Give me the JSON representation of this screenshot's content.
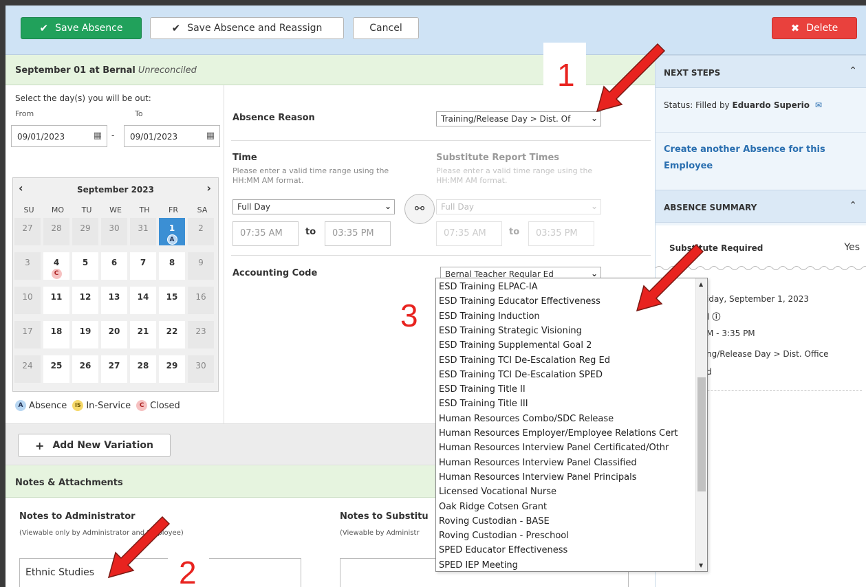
{
  "toolbar": {
    "save_absence": "Save Absence",
    "save_reassign": "Save Absence and Reassign",
    "cancel": "Cancel",
    "delete": "Delete"
  },
  "absence": {
    "title": "September 01 at Bernal",
    "status": "Unreconciled",
    "select_days": "Select the day(s) you will be out:",
    "from_label": "From",
    "to_label": "To",
    "from_date": "09/01/2023",
    "to_date": "09/01/2023",
    "dash": "-"
  },
  "calendar": {
    "title": "September 2023",
    "days_of_week": [
      "SU",
      "MO",
      "TU",
      "WE",
      "TH",
      "FR",
      "SA"
    ],
    "weeks": [
      [
        "27",
        "28",
        "29",
        "30",
        "31",
        "1",
        "2"
      ],
      [
        "3",
        "4",
        "5",
        "6",
        "7",
        "8",
        "9"
      ],
      [
        "10",
        "11",
        "12",
        "13",
        "14",
        "15",
        "16"
      ],
      [
        "17",
        "18",
        "19",
        "20",
        "21",
        "22",
        "23"
      ],
      [
        "24",
        "25",
        "26",
        "27",
        "28",
        "29",
        "30"
      ]
    ],
    "selected_badge": "A",
    "closed_badge": "C"
  },
  "legend": {
    "absence_badge": "A",
    "absence": "Absence",
    "inservice_badge": "IS",
    "inservice": "In-Service",
    "closed_badge": "C",
    "closed": "Closed"
  },
  "form": {
    "absence_reason_label": "Absence Reason",
    "absence_reason_value": "Training/Release Day > Dist. Of",
    "time_label": "Time",
    "time_hint": "Please enter a valid time range using the HH:MM AM format.",
    "time_value": "Full Day",
    "start_time": "07:35 AM",
    "to": "to",
    "end_time": "03:35 PM",
    "sub_times_label": "Substitute Report Times",
    "sub_hint": "Please enter a valid time range using the HH:MM AM format.",
    "sub_value": "Full Day",
    "sub_start": "07:35 AM",
    "sub_end": "03:35 PM",
    "accounting_label": "Accounting Code",
    "accounting_value": "Bernal Teacher Regular Ed"
  },
  "dropdown_options": [
    "ESD Training ELPAC-IA",
    "ESD Training Educator Effectiveness",
    "ESD Training Induction",
    "ESD Training Strategic Visioning",
    "ESD Training Supplemental Goal 2",
    "ESD Training TCI De-Escalation Reg Ed",
    "ESD Training TCI De-Escalation SPED",
    "ESD Training Title II",
    "ESD Training Title III",
    "Human Resources Combo/SDC Release",
    "Human Resources Employer/Employee Relations Cert",
    "Human Resources Interview Panel Certificated/Othr",
    "Human Resources Interview Panel Classified",
    "Human Resources Interview Panel Principals",
    "Licensed Vocational Nurse",
    "Oak Ridge Cotsen Grant",
    "Roving Custodian - BASE",
    "Roving Custodian - Preschool",
    "SPED Educator Effectiveness",
    "SPED IEP Meeting"
  ],
  "add_variation": "Add New Variation",
  "notes": {
    "header": "Notes & Attachments",
    "admin_title": "Notes to Administrator",
    "admin_sub": "(Viewable only by Administrator and Employee)",
    "admin_value": "Ethnic Studies",
    "sub_title": "Notes to Substitu",
    "sub_sub": "(Viewable by Administr"
  },
  "right": {
    "next_steps": "NEXT STEPS",
    "status_prefix": "Status: Filled by ",
    "status_name": "Eduardo Superio",
    "create_link": "Create another Absence for this Employee",
    "summary": "ABSENCE SUMMARY",
    "sub_required": "Substitute Required",
    "yes": "Yes",
    "date_line": "iday, September 1, 2023",
    "day_type": "l",
    "time_line": "M - 3:35 PM",
    "reason_line": "ng/Release Day > Dist. Office",
    "extra_line": "d"
  },
  "annotations": {
    "n1": "1",
    "n2": "2",
    "n3": "3"
  },
  "colors": {
    "save": "#21a15b",
    "delete": "#e9413d",
    "arrow": "#e8231f",
    "link": "#2a6fb0"
  }
}
